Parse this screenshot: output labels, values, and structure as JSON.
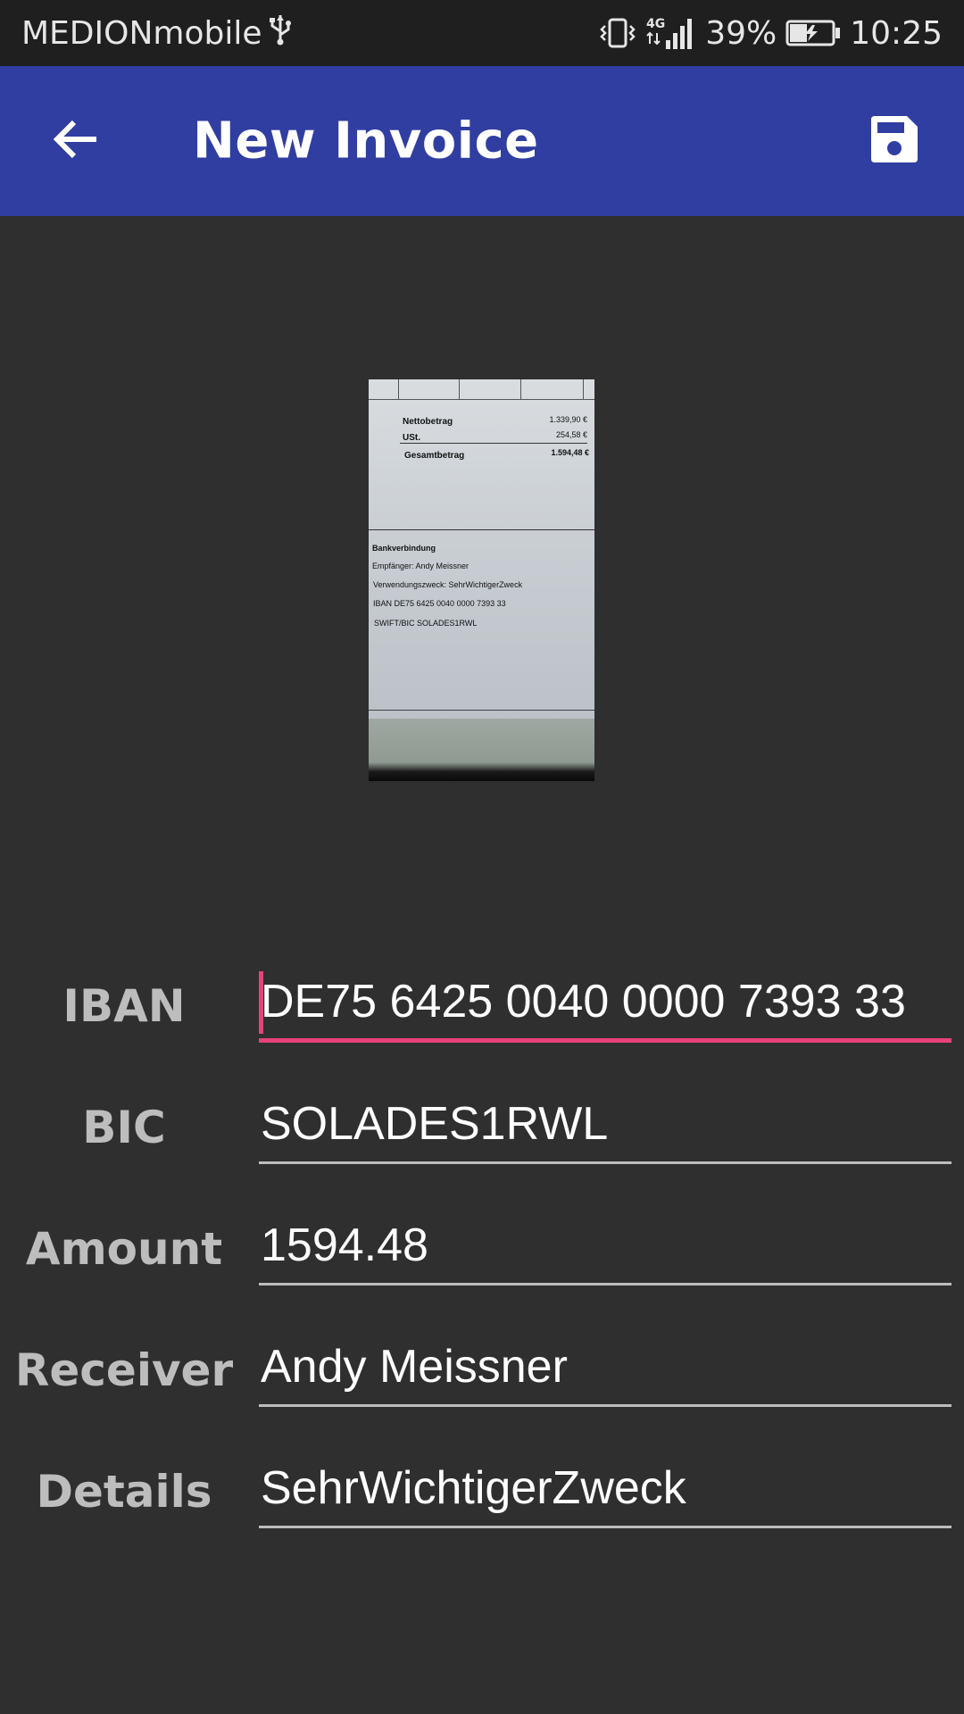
{
  "status_bar": {
    "carrier": "MEDIONmobile",
    "usb_icon": "usb-icon",
    "vibrate_icon": "vibrate-icon",
    "network_type": "4G",
    "battery_percent": "39%",
    "time": "10:25"
  },
  "app_bar": {
    "title": "New Invoice",
    "back_icon": "arrow-left-icon",
    "save_icon": "floppy-disk-icon",
    "color": "#303ea1"
  },
  "preview": {
    "lines": [
      {
        "label": "Nettobetrag",
        "value": "1.339,90 €"
      },
      {
        "label": "USt.",
        "value": "254,58 €"
      },
      {
        "label": "Gesamtbetrag",
        "value": "1.594,48 €"
      }
    ],
    "bank_heading": "Bankverbindung",
    "bank_lines": [
      "Empfänger:  Andy Meissner",
      "Verwendungszweck:  SehrWichtigerZweck",
      "IBAN  DE75 6425 0040 0000 7393 33",
      "SWIFT/BIC  SOLADES1RWL"
    ]
  },
  "form": {
    "iban": {
      "label": "IBAN",
      "value": "DE75 6425 0040 0000 7393 33"
    },
    "bic": {
      "label": "BIC",
      "value": "SOLADES1RWL"
    },
    "amount": {
      "label": "Amount",
      "value": "1594.48"
    },
    "receiver": {
      "label": "Receiver",
      "value": "Andy Meissner"
    },
    "details": {
      "label": "Details",
      "value": "SehrWichtigerZweck"
    }
  },
  "colors": {
    "accent": "#e84279",
    "background": "#2f2f2f",
    "label": "#bdbdbd"
  }
}
